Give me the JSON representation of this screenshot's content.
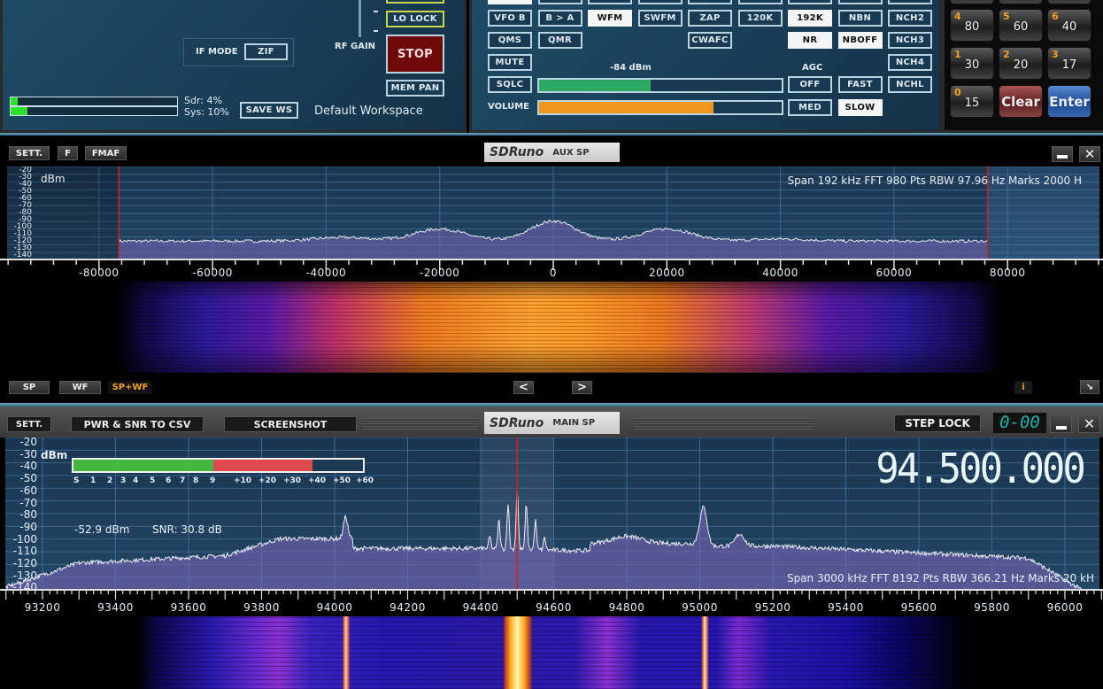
{
  "top_left": {
    "lo_lock": "LO LOCK",
    "rf_gain": "RF GAIN",
    "stop": "STOP",
    "mem_pan": "MEM PAN",
    "if_mode_label": "IF MODE",
    "if_mode_value": "ZIF",
    "sdr_load": "Sdr: 4%",
    "sys_load": "Sys: 10%",
    "sdr_load_pct": 4,
    "sys_load_pct": 10,
    "save_ws": "SAVE WS",
    "workspace": "Default Workspace"
  },
  "rx_panel": {
    "row1": [
      "VFO B",
      "B > A",
      "WFM",
      "SWFM",
      "ZAP",
      "120K",
      "192K",
      "NBN",
      "NCH2"
    ],
    "row1_active": [
      "WFM",
      "192K"
    ],
    "qms": "QMS",
    "qmr": "QMR",
    "cwafc": "CWAFC",
    "nr": "NR",
    "nboff": "NBOFF",
    "nch3": "NCH3",
    "mute": "MUTE",
    "signal_level": "-84 dBm",
    "agc": "AGC",
    "nch4": "NCH4",
    "sqlc": "SQLC",
    "squelch_pct": 46,
    "agc_off": "OFF",
    "agc_fast": "FAST",
    "nchl": "NCHL",
    "volume": "VOLUME",
    "volume_pct": 72,
    "agc_med": "MED",
    "agc_slow": "SLOW",
    "active_color": "#f4f6f6",
    "squelch_color": "#2fa866",
    "volume_color": "#f0961e"
  },
  "keypad": {
    "keys": [
      {
        "num": "4",
        "val": "80"
      },
      {
        "num": "5",
        "val": "60"
      },
      {
        "num": "6",
        "val": "40"
      },
      {
        "num": "1",
        "val": "30"
      },
      {
        "num": "2",
        "val": "20"
      },
      {
        "num": "3",
        "val": "17"
      },
      {
        "num": "0",
        "val": "15"
      }
    ],
    "clear": "Clear",
    "enter": "Enter"
  },
  "aux_sp": {
    "sett": "SETT.",
    "f": "F",
    "fmaf": "FMAF",
    "brand": "SDRuno",
    "title": "AUX SP",
    "unit": "dBm",
    "y_ticks": [
      "-20",
      "-30",
      "-40",
      "-50",
      "-60",
      "-70",
      "-80",
      "-90",
      "-100",
      "-110",
      "-120",
      "-130",
      "-140"
    ],
    "x_ticks": [
      "-80000",
      "-60000",
      "-40000",
      "-20000",
      "0",
      "20000",
      "40000",
      "60000",
      "80000"
    ],
    "info": "Span 192 kHz  FFT 980 Pts  RBW 97.96 Hz  Marks 2000 H",
    "sp": "SP",
    "wf": "WF",
    "spwf": "SP+WF",
    "prev": "<",
    "next": ">",
    "info_btn": "i"
  },
  "main_sp": {
    "sett": "SETT.",
    "csv": "PWR & SNR TO CSV",
    "screenshot": "SCREENSHOT",
    "brand": "SDRuno",
    "title": "MAIN SP",
    "step_lock": "STEP LOCK",
    "step_display": "0-00",
    "unit": "dBm",
    "y_ticks": [
      "-20",
      "-30",
      "-40",
      "-50",
      "-60",
      "-70",
      "-80",
      "-90",
      "-100",
      "-110",
      "-120",
      "-130",
      "-140"
    ],
    "x_ticks": [
      "93200",
      "93400",
      "93600",
      "93800",
      "94000",
      "94200",
      "94400",
      "94600",
      "94800",
      "95000",
      "95200",
      "95400",
      "95600",
      "95800",
      "96000"
    ],
    "smeter_labels": [
      "S",
      "1",
      "2",
      "3",
      "4",
      "5",
      "6",
      "7",
      "8",
      "9",
      "+10",
      "+20",
      "+30",
      "+40",
      "+50",
      "+60"
    ],
    "power": "-52.9 dBm",
    "snr": "SNR: 30.8 dB",
    "frequency": "94.500.000",
    "info": "Span 3000 kHz  FFT 8192 Pts  RBW 366.21 Hz  Marks 20 kH"
  }
}
